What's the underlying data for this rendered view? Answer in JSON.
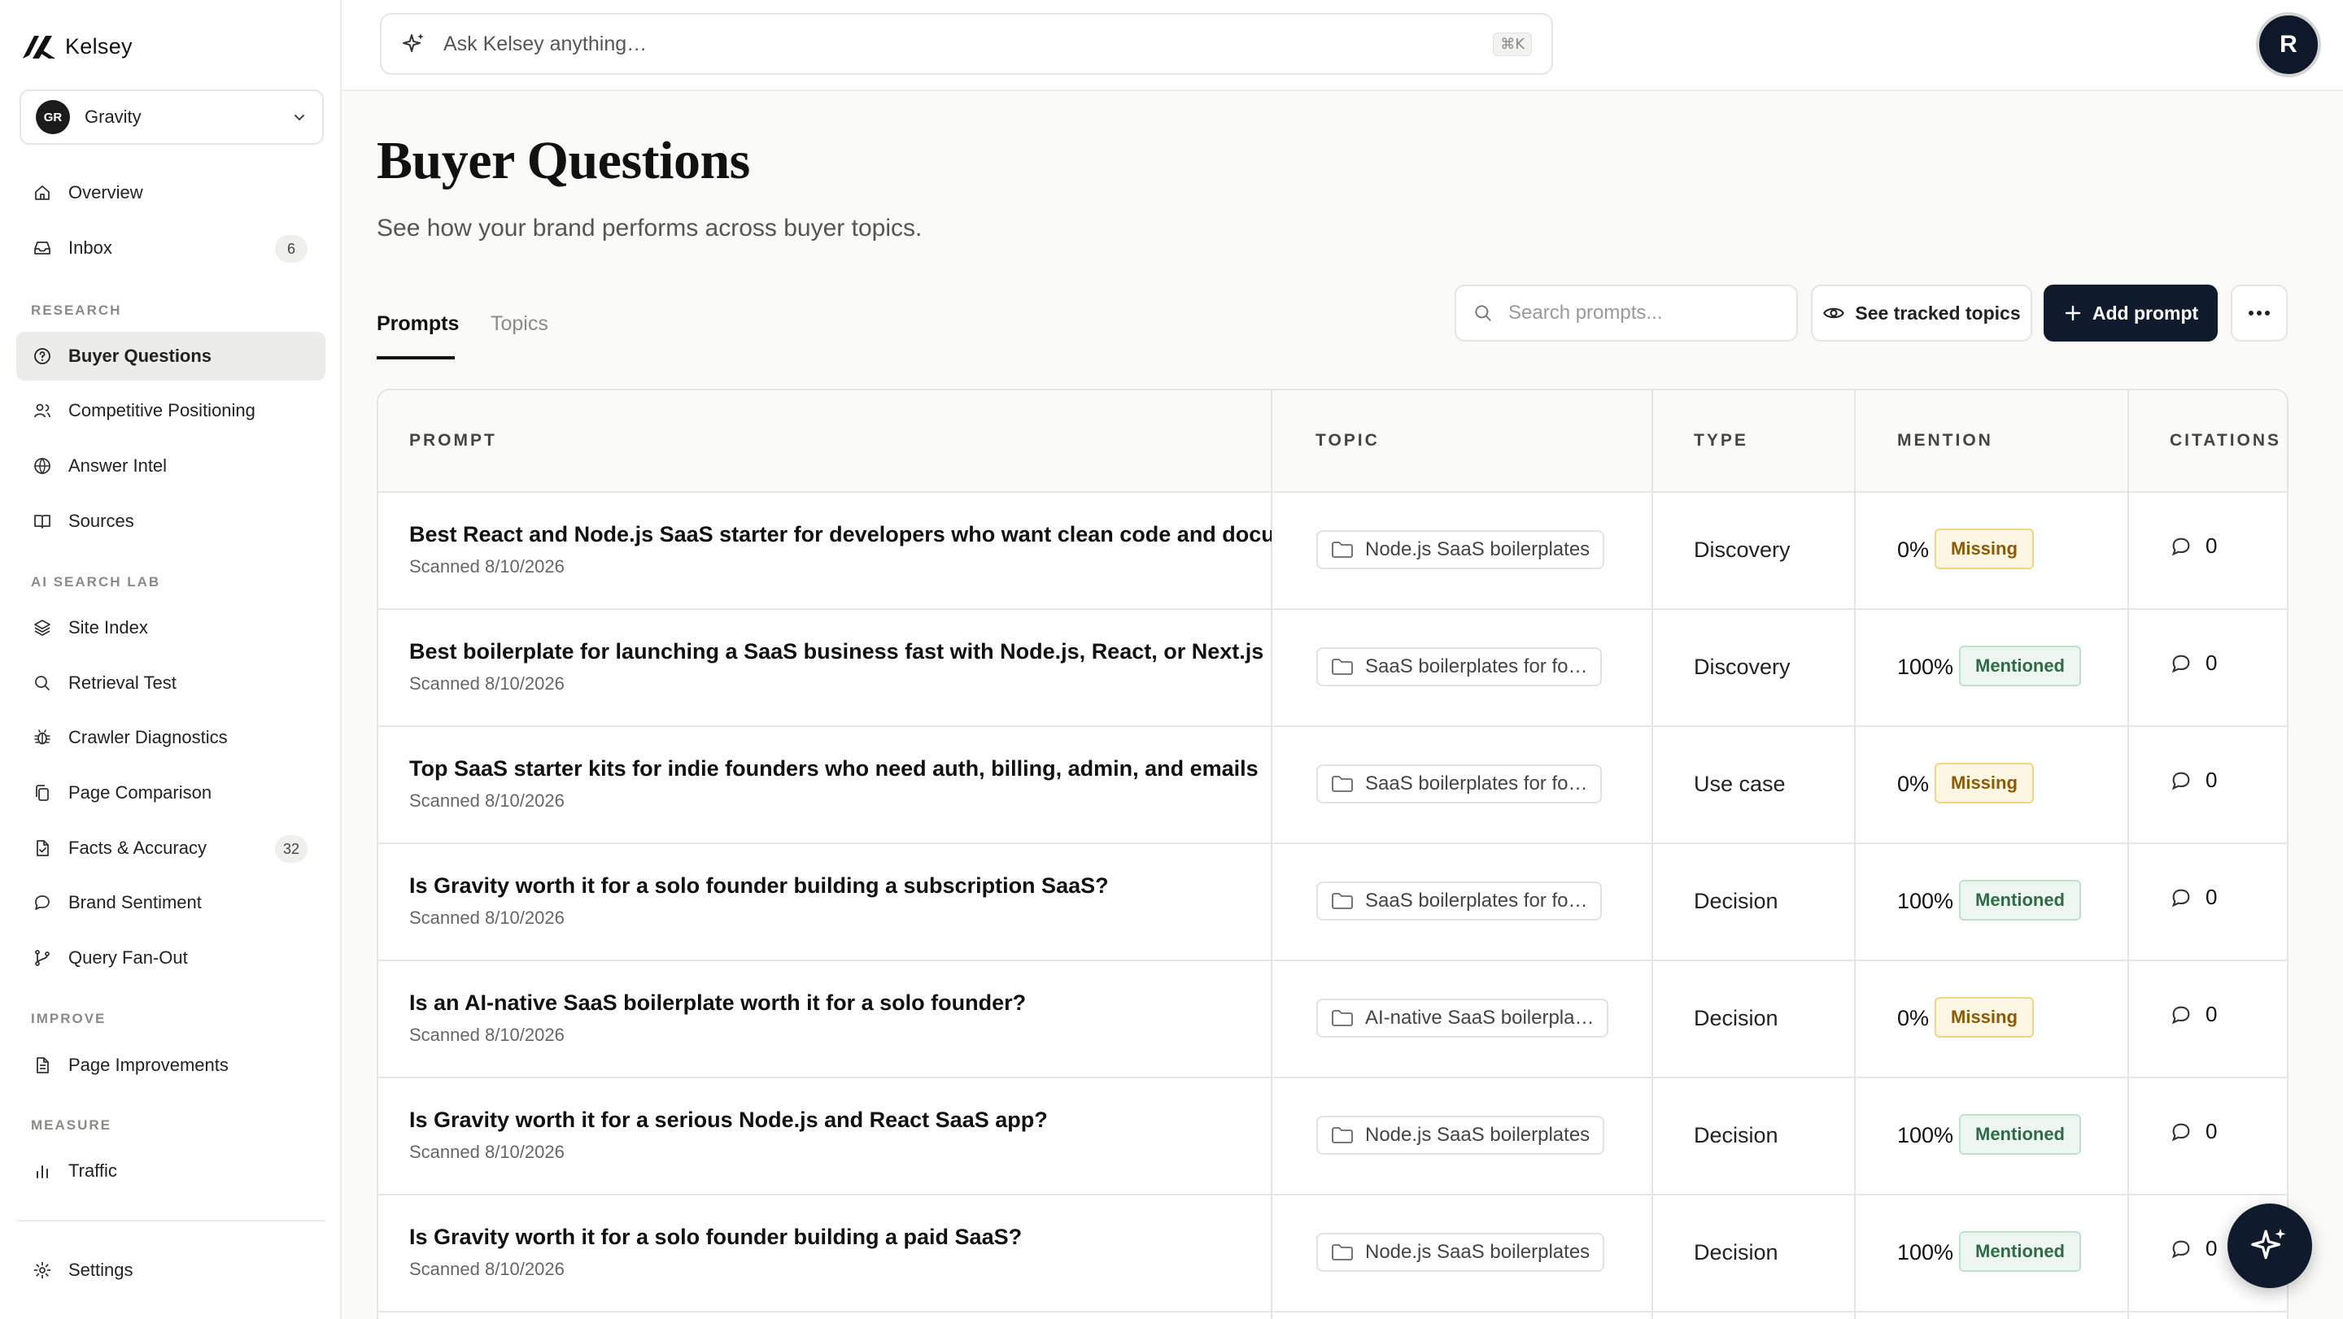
{
  "app": {
    "logo_text": "Kelsey",
    "workspace": {
      "initials": "GR",
      "name": "Gravity"
    }
  },
  "sidebar": {
    "top_items": [
      {
        "label": "Overview",
        "icon": "home-icon"
      },
      {
        "label": "Inbox",
        "icon": "inbox-icon",
        "badge": "6"
      }
    ],
    "sections": [
      {
        "title": "RESEARCH",
        "items": [
          {
            "label": "Buyer Questions",
            "icon": "question-circle-icon",
            "active": true
          },
          {
            "label": "Competitive Positioning",
            "icon": "users-icon"
          },
          {
            "label": "Answer Intel",
            "icon": "globe-icon"
          },
          {
            "label": "Sources",
            "icon": "book-icon"
          }
        ]
      },
      {
        "title": "AI SEARCH LAB",
        "items": [
          {
            "label": "Site Index",
            "icon": "layers-icon"
          },
          {
            "label": "Retrieval Test",
            "icon": "search-icon"
          },
          {
            "label": "Crawler Diagnostics",
            "icon": "bug-icon"
          },
          {
            "label": "Page Comparison",
            "icon": "copy-icon"
          },
          {
            "label": "Facts & Accuracy",
            "icon": "file-check-icon",
            "badge": "32"
          },
          {
            "label": "Brand Sentiment",
            "icon": "chat-icon"
          },
          {
            "label": "Query Fan-Out",
            "icon": "branch-icon"
          }
        ]
      },
      {
        "title": "IMPROVE",
        "items": [
          {
            "label": "Page Improvements",
            "icon": "document-icon"
          }
        ]
      },
      {
        "title": "MEASURE",
        "items": [
          {
            "label": "Traffic",
            "icon": "bar-chart-icon"
          }
        ]
      }
    ],
    "settings": {
      "label": "Settings",
      "icon": "gear-icon"
    }
  },
  "topbar": {
    "ask_placeholder": "Ask Kelsey anything…",
    "shortcut": "⌘K",
    "user_initial": "R"
  },
  "page": {
    "title": "Buyer Questions",
    "subtitle": "See how your brand performs across buyer topics.",
    "tabs": [
      {
        "label": "Prompts",
        "active": true
      },
      {
        "label": "Topics",
        "active": false
      }
    ],
    "search_placeholder": "Search prompts...",
    "see_tracked_label": "See tracked topics",
    "add_prompt_label": "Add prompt"
  },
  "table": {
    "columns": [
      "PROMPT",
      "TOPIC",
      "TYPE",
      "MENTION",
      "CITATIONS"
    ],
    "rows": [
      {
        "prompt": "Best React and Node.js SaaS starter for developers who want clean code and documentation",
        "scanned": "Scanned 8/10/2026",
        "topic": "Node.js SaaS boilerplates",
        "type": "Discovery",
        "mention_pct": "0%",
        "mention_status": "Missing",
        "citations": "0"
      },
      {
        "prompt": "Best boilerplate for launching a SaaS business fast with Node.js, React, or Next.js",
        "scanned": "Scanned 8/10/2026",
        "topic": "SaaS boilerplates for fo…",
        "type": "Discovery",
        "mention_pct": "100%",
        "mention_status": "Mentioned",
        "citations": "0"
      },
      {
        "prompt": "Top SaaS starter kits for indie founders who need auth, billing, admin, and emails",
        "scanned": "Scanned 8/10/2026",
        "topic": "SaaS boilerplates for fo…",
        "type": "Use case",
        "mention_pct": "0%",
        "mention_status": "Missing",
        "citations": "0"
      },
      {
        "prompt": "Is Gravity worth it for a solo founder building a subscription SaaS?",
        "scanned": "Scanned 8/10/2026",
        "topic": "SaaS boilerplates for fo…",
        "type": "Decision",
        "mention_pct": "100%",
        "mention_status": "Mentioned",
        "citations": "0"
      },
      {
        "prompt": "Is an AI-native SaaS boilerplate worth it for a solo founder?",
        "scanned": "Scanned 8/10/2026",
        "topic": "AI-native SaaS boilerpla…",
        "type": "Decision",
        "mention_pct": "0%",
        "mention_status": "Missing",
        "citations": "0"
      },
      {
        "prompt": "Is Gravity worth it for a serious Node.js and React SaaS app?",
        "scanned": "Scanned 8/10/2026",
        "topic": "Node.js SaaS boilerplates",
        "type": "Decision",
        "mention_pct": "100%",
        "mention_status": "Mentioned",
        "citations": "0"
      },
      {
        "prompt": "Is Gravity worth it for a solo founder building a paid SaaS?",
        "scanned": "Scanned 8/10/2026",
        "topic": "Node.js SaaS boilerplates",
        "type": "Decision",
        "mention_pct": "100%",
        "mention_status": "Mentioned",
        "citations": "0"
      }
    ]
  },
  "colors": {
    "primary_dark": "#0f1b2d",
    "missing_bg": "#fdf6e3",
    "missing_text": "#8a5a06",
    "mentioned_bg": "#eef6f1",
    "mentioned_text": "#2f6b45"
  }
}
